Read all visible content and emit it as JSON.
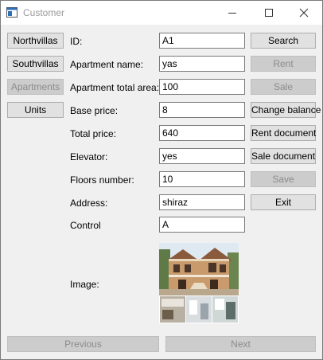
{
  "window": {
    "title": "Customer",
    "minimize_glyph": "—",
    "maximize_glyph": "☐",
    "close_glyph": "✕"
  },
  "left_buttons": {
    "northvillas": "Northvillas",
    "southvillas": "Southvillas",
    "apartments": "Apartments",
    "units": "Units"
  },
  "form": {
    "id_label": "ID:",
    "id_value": "A1",
    "apartment_name_label": "Apartment name:",
    "apartment_name_value": "yas",
    "apartment_total_area_label": "Apartment total area:",
    "apartment_total_area_value": "100",
    "base_price_label": "Base price:",
    "base_price_value": "8",
    "total_price_label": "Total price:",
    "total_price_value": "640",
    "elevator_label": "Elevator:",
    "elevator_value": "yes",
    "floors_number_label": "Floors number:",
    "floors_number_value": "10",
    "address_label": "Address:",
    "address_value": "shiraz",
    "control_label": "Control",
    "control_value": "A",
    "image_label": "Image:"
  },
  "right_buttons": {
    "search": "Search",
    "rent": "Rent",
    "sale": "Sale",
    "change_balance": "Change balance",
    "rent_document": "Rent document",
    "sale_document": "Sale document",
    "save": "Save",
    "exit": "Exit"
  },
  "nav": {
    "previous": "Previous",
    "next": "Next"
  },
  "colors": {
    "background": "#f0f0f0",
    "button": "#e1e1e1",
    "button_disabled": "#cccccc",
    "disabled_text": "#8c8c8c"
  }
}
